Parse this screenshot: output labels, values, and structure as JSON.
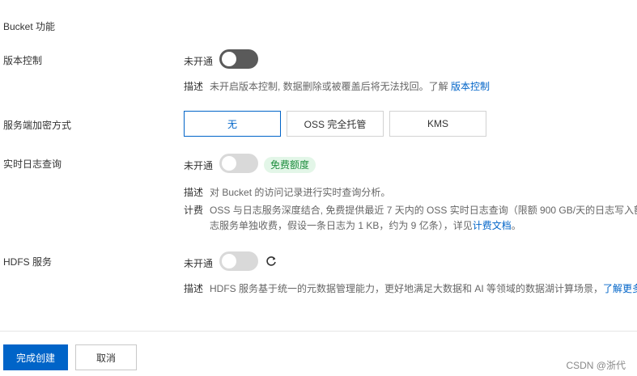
{
  "section": {
    "title": "Bucket 功能"
  },
  "versioning": {
    "label": "版本控制",
    "status": "未开通",
    "desc_key": "描述",
    "desc_text": "未开启版本控制, 数据删除或被覆盖后将无法找回。了解 ",
    "desc_link": "版本控制"
  },
  "encryption": {
    "label": "服务端加密方式",
    "options": [
      "无",
      "OSS 完全托管",
      "KMS"
    ],
    "selected": "无"
  },
  "realtime_log": {
    "label": "实时日志查询",
    "status": "未开通",
    "badge": "免费额度",
    "desc_key": "描述",
    "desc_text": "对 Bucket 的访问记录进行实时查询分析。",
    "billing_key": "计费",
    "billing_line1": "OSS 与日志服务深度结合, 免费提供最近 7 天内的 OSS 实时日志查询（限额 900 GB/天的日志写入额",
    "billing_line2": "志服务单独收费，假设一条日志为 1 KB，约为 9 亿条），详见",
    "billing_link": "计费文档",
    "billing_end": "。"
  },
  "hdfs": {
    "label": "HDFS 服务",
    "status": "未开通",
    "desc_key": "描述",
    "desc_text": "HDFS 服务基于统一的元数据管理能力，更好地满足大数据和 AI 等领域的数据湖计算场景，",
    "desc_link": "了解更多"
  },
  "footer": {
    "submit_label": "完成创建",
    "cancel_label": "取消",
    "watermark": "CSDN @浙代"
  },
  "colors": {
    "primary": "#0064c8",
    "badge_bg": "#e3f6e8",
    "badge_text": "#1e8e3e",
    "warning": "#e59700"
  },
  "icons": {
    "hdfs_refresh": "refresh-icon"
  }
}
